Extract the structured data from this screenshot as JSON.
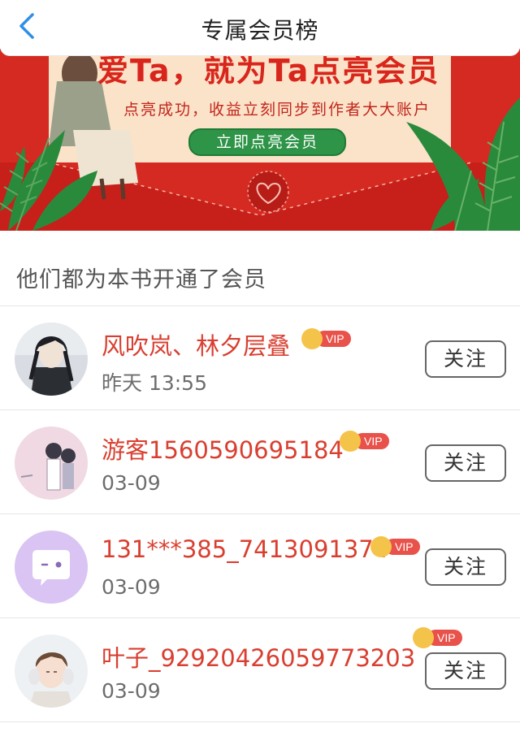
{
  "header": {
    "title": "专属会员榜",
    "back_icon": "chevron-left-icon"
  },
  "banner": {
    "headline": "爱Ta，就为Ta点亮会员",
    "subtitle": "点亮成功，收益立刻同步到作者大大账户",
    "cta_label": "立即点亮会员",
    "colors": {
      "background": "#d42a22",
      "card": "#fbe3c9",
      "button": "#2e9447",
      "leaf": "#2a8a3c"
    }
  },
  "section": {
    "title": "他们都为本书开通了会员"
  },
  "vip_label": "VIP",
  "members": [
    {
      "name": "风吹岚、林夕层叠",
      "time": "昨天 13:55",
      "follow_label": "关注",
      "avatar": "anime-boy-avatar"
    },
    {
      "name": "游客1560590695184",
      "time": "03-09",
      "follow_label": "关注",
      "avatar": "anime-couple-avatar"
    },
    {
      "name": "131***385_7413091374",
      "time": "03-09",
      "follow_label": "关注",
      "avatar": "chat-bubble-avatar"
    },
    {
      "name": "叶子_92920426059773203",
      "time": "03-09",
      "follow_label": "关注",
      "avatar": "boy-headphones-avatar"
    }
  ],
  "colors": {
    "name_text": "#d93f30",
    "vip_badge": "#e8524a",
    "crown": "#f4c34a"
  }
}
